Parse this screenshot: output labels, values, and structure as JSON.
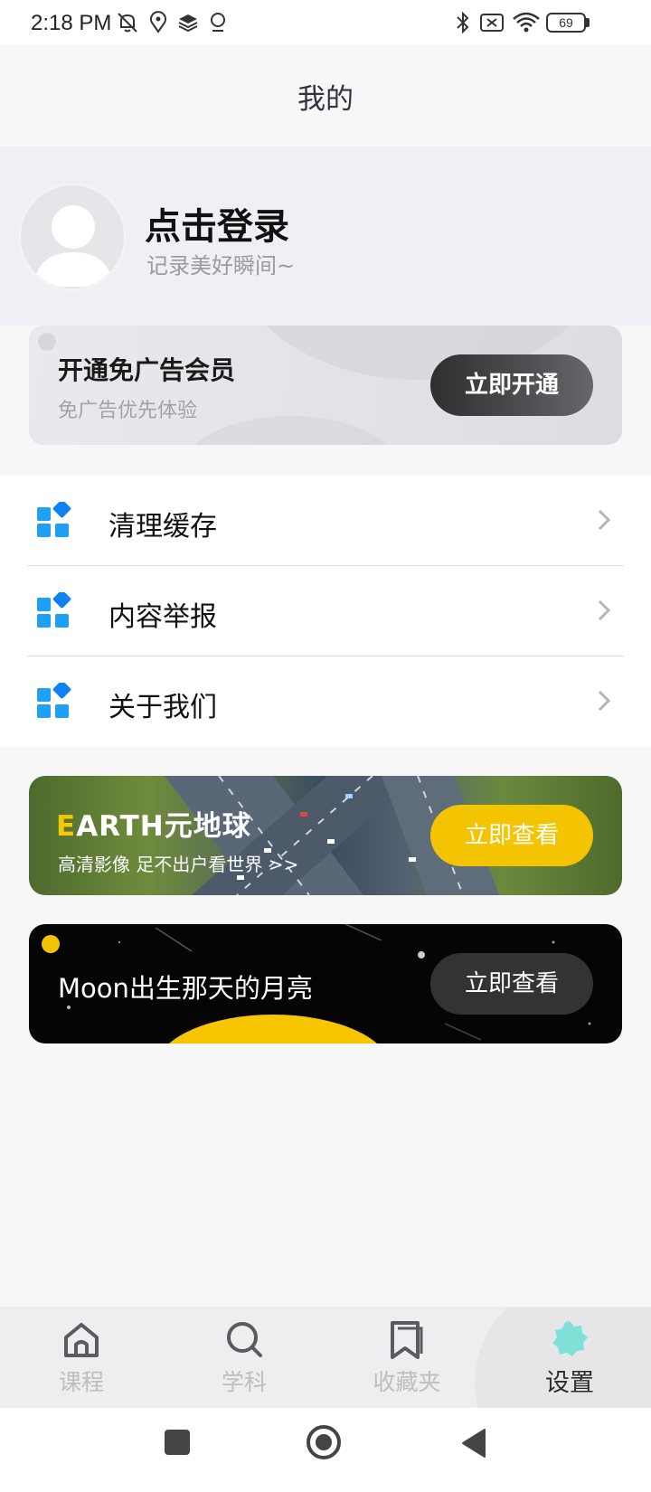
{
  "status_bar": {
    "time": "2:18 PM",
    "battery": "69",
    "icons": [
      "mute-icon",
      "location-icon",
      "layers-icon",
      "badge-icon",
      "bluetooth-icon",
      "no-sim-icon",
      "wifi-icon",
      "battery-icon"
    ]
  },
  "header": {
    "title": "我的"
  },
  "profile": {
    "title": "点击登录",
    "subtitle": "记录美好瞬间~"
  },
  "vip": {
    "title": "开通免广告会员",
    "subtitle": "免广告优先体验",
    "button": "立即开通"
  },
  "menu": {
    "items": [
      {
        "label": "清理缓存",
        "icon": "grid-icon"
      },
      {
        "label": "内容举报",
        "icon": "grid-icon"
      },
      {
        "label": "关于我们",
        "icon": "grid-icon"
      }
    ]
  },
  "earth": {
    "title_first": "E",
    "title_rest": "ARTH元地球",
    "subtitle": "高清影像 足不出户看世界 >>",
    "button": "立即查看"
  },
  "moon": {
    "title": "Moon出生那天的月亮",
    "button": "立即查看"
  },
  "tabbar": {
    "tabs": [
      {
        "label": "课程",
        "icon": "home-icon",
        "active": false
      },
      {
        "label": "学科",
        "icon": "search-icon",
        "active": false
      },
      {
        "label": "收藏夹",
        "icon": "bookmark-icon",
        "active": false
      },
      {
        "label": "设置",
        "icon": "settings-icon",
        "active": true
      }
    ]
  },
  "colors": {
    "accent_yellow": "#f5c400",
    "icon_blue": "#1ea0f5",
    "active_tab": "#2c2c30",
    "settings_icon": "#7fe0d8"
  }
}
